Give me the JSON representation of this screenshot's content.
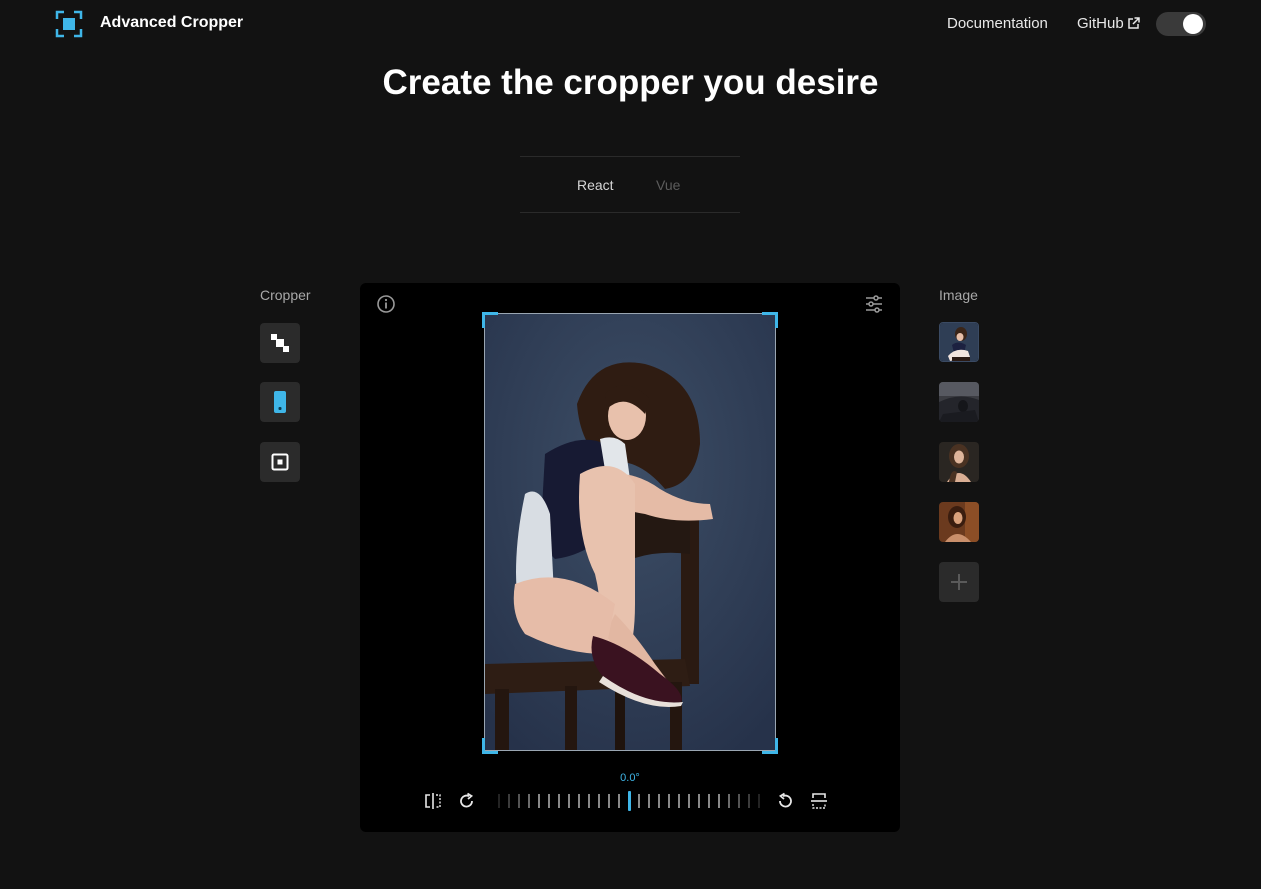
{
  "header": {
    "brand": "Advanced Cropper",
    "nav": {
      "documentation": "Documentation",
      "github": "GitHub"
    },
    "theme_toggle": "on"
  },
  "hero": {
    "title": "Create the cropper you desire"
  },
  "tabs": {
    "react": "React",
    "vue": "Vue",
    "active": "React"
  },
  "cropper_panel": {
    "label": "Cropper",
    "options": [
      "crop-rect-icon",
      "mobile-cropper-icon",
      "fixed-cropper-icon"
    ]
  },
  "image_panel": {
    "label": "Image",
    "add_icon": "plus-icon"
  },
  "editor": {
    "rotation": "0.0°",
    "accent_color": "#3fb6e8"
  }
}
